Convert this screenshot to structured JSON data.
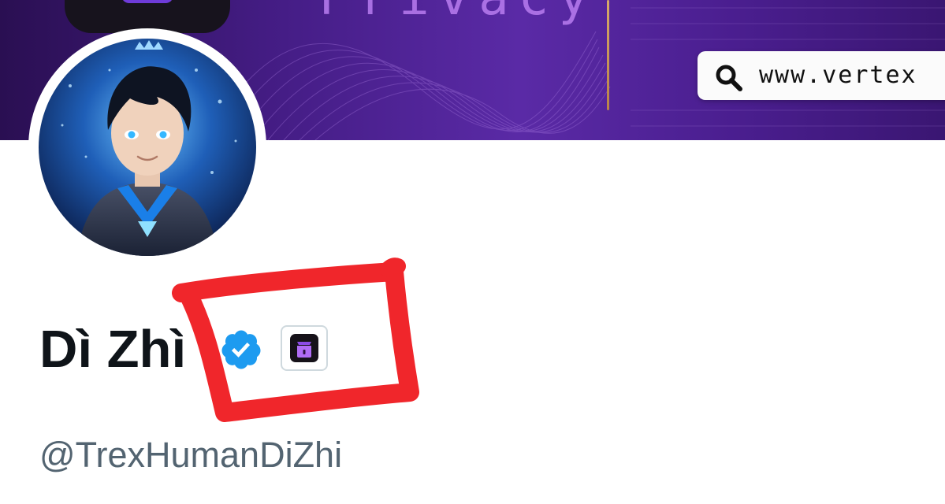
{
  "banner": {
    "word": "Privacy",
    "url": "www.vertex",
    "colors": {
      "dark": "#2a0f52",
      "mid": "#5a2aa6",
      "accent": "#b97df0"
    }
  },
  "profile": {
    "display_name": "Dì Zhì",
    "handle": "@TrexHumanDiZhi",
    "verified": true,
    "verified_color": "#1d9bf0",
    "affiliate_badge_icon": "purple-box-icon"
  },
  "annotation": {
    "shape": "hand-drawn-rectangle",
    "color": "#f0262b"
  }
}
